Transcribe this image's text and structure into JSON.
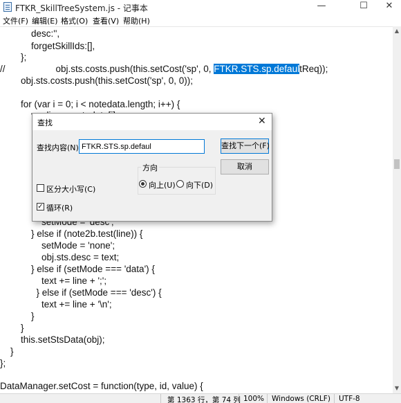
{
  "window": {
    "title": "FTKR_SkillTreeSystem.js - 记事本",
    "minimize_glyph": "—",
    "maximize_glyph": "☐",
    "close_glyph": "✕"
  },
  "menu": {
    "items": [
      "文件(F)",
      "编辑(E)",
      "格式(O)",
      "查看(V)",
      "帮助(H)"
    ]
  },
  "editor": {
    "lines": [
      "            desc:'',",
      "            forgetSkillIds:[],",
      "        };",
      "            obj.sts.costs.push(this.setCost('sp', 0, ",
      "        obj.sts.costs.push(this.setCost('sp', 0, 0));",
      "",
      "        for (var i = 0; i < notedata.length; i++) {",
      "            var line = notedata[i];",
      "                setMode = 'desc';",
      "            } else if (note2b.test(line)) {",
      "                setMode = 'none';",
      "                obj.sts.desc = text;",
      "            } else if (setMode === 'data') {",
      "                text += line + ';';",
      "              } else if (setMode === 'desc') {",
      "                text += line + '\\n';",
      "            }",
      "        }",
      "        this.setStsData(obj);",
      "    }",
      "};",
      "",
      "DataManager.setCost = function(type, id, value) {"
    ],
    "comment_prefix": "//",
    "selected_text": "FTKR.STS.sp.defaul",
    "line4_tail": "tReq));"
  },
  "statusbar": {
    "position": "第 1363 行，第 74 列",
    "zoom": "100%",
    "line_ending": "Windows (CRLF)",
    "encoding": "UTF-8"
  },
  "find_dialog": {
    "title": "查找",
    "find_label": "查找内容(N):",
    "find_value": "FTKR.STS.sp.defaul",
    "find_next_button": "查找下一个(F)",
    "cancel_button": "取消",
    "direction_label": "方向",
    "direction_up": "向上(U)",
    "direction_down": "向下(D)",
    "direction_selected": "up",
    "match_case_label": "区分大小写(C)",
    "match_case_checked": false,
    "wrap_label": "循环(R)",
    "wrap_checked": true,
    "close_glyph": "✕"
  }
}
